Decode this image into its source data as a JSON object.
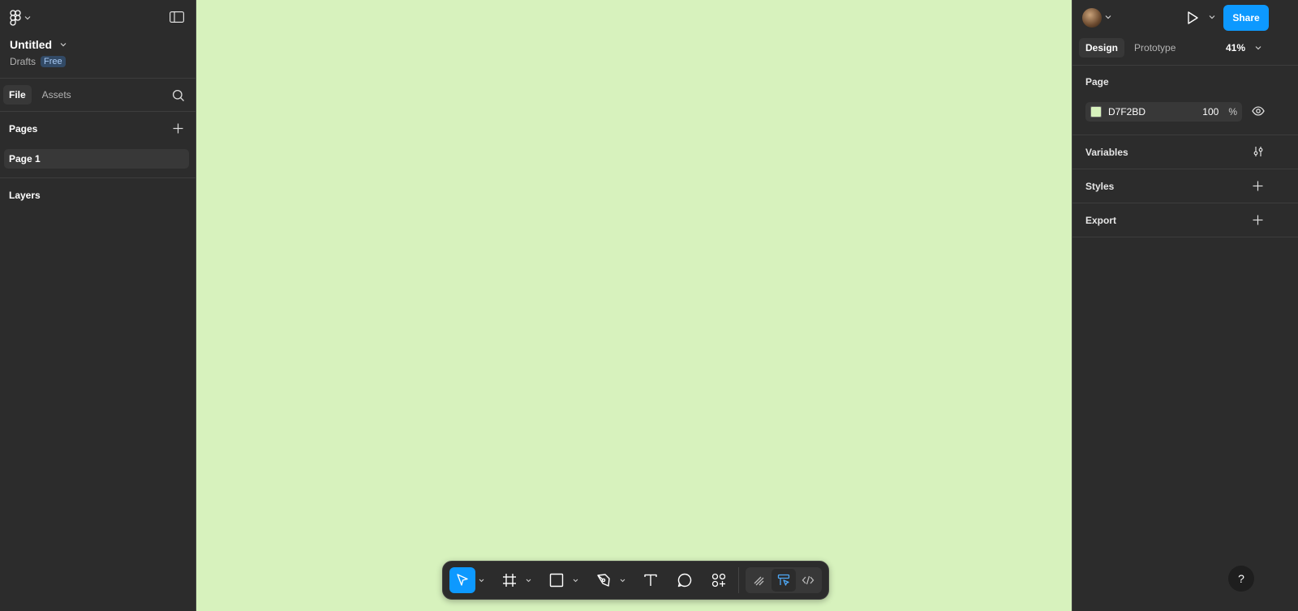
{
  "colors": {
    "canvas": "#D7F2BD",
    "accent": "#0d99ff",
    "panel": "#2c2c2c"
  },
  "left": {
    "file_title": "Untitled",
    "location": "Drafts",
    "plan_badge": "Free",
    "tabs": [
      {
        "label": "File",
        "active": true
      },
      {
        "label": "Assets",
        "active": false
      }
    ],
    "pages_label": "Pages",
    "pages": [
      {
        "label": "Page 1",
        "active": true
      }
    ],
    "layers_label": "Layers"
  },
  "right": {
    "share_label": "Share",
    "tabs": [
      {
        "label": "Design",
        "active": true
      },
      {
        "label": "Prototype",
        "active": false
      }
    ],
    "zoom": "41%",
    "page_section": "Page",
    "page_color_hex": "D7F2BD",
    "page_opacity": "100",
    "page_opacity_unit": "%",
    "variables_label": "Variables",
    "styles_label": "Styles",
    "export_label": "Export",
    "help_label": "?"
  },
  "toolbar": {
    "tools": [
      "move-icon",
      "frame-icon",
      "rectangle-icon",
      "pen-icon",
      "text-icon",
      "comment-icon",
      "actions-icon"
    ],
    "modes": [
      "draw-mode-icon",
      "design-mode-icon",
      "dev-mode-icon"
    ]
  }
}
